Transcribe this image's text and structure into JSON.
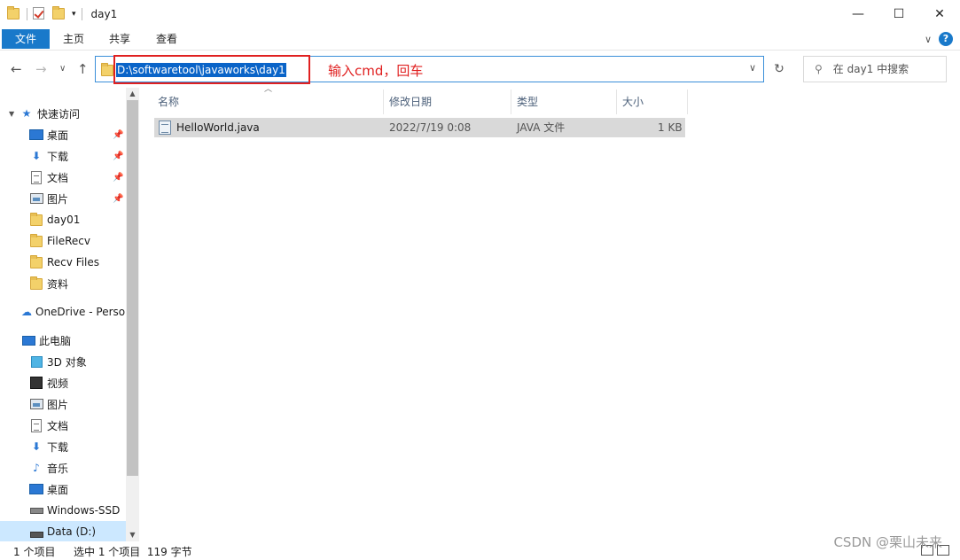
{
  "window": {
    "title": "day1",
    "minimize_glyph": "—",
    "maximize_glyph": "☐",
    "close_glyph": "✕"
  },
  "ribbon": {
    "tabs": [
      "文件",
      "主页",
      "共享",
      "查看"
    ],
    "collapse_glyph": "∨",
    "help_glyph": "?"
  },
  "navbar": {
    "back_glyph": "←",
    "forward_glyph": "→",
    "recent_glyph": "∨",
    "up_glyph": "↑",
    "address": "D:\\softwaretool\\javaworks\\day1",
    "dropdown_glyph": "∨",
    "refresh_glyph": "↻",
    "search_placeholder": "在 day1 中搜索",
    "search_glyph": "⚲"
  },
  "annotation": {
    "text": "输入cmd，回车",
    "color": "#e02020"
  },
  "sidebar": {
    "quick_access": "快速访问",
    "quick_items": [
      {
        "label": "桌面",
        "pinned": true
      },
      {
        "label": "下载",
        "pinned": true
      },
      {
        "label": "文档",
        "pinned": true
      },
      {
        "label": "图片",
        "pinned": true
      },
      {
        "label": "day01",
        "pinned": false
      },
      {
        "label": "FileRecv",
        "pinned": false
      },
      {
        "label": "Recv Files",
        "pinned": false
      },
      {
        "label": "资料",
        "pinned": false
      }
    ],
    "onedrive": "OneDrive - Personal",
    "this_pc": "此电脑",
    "pc_items": [
      "3D 对象",
      "视频",
      "图片",
      "文档",
      "下载",
      "音乐",
      "桌面",
      "Windows-SSD",
      "Data (D:)"
    ],
    "pin_glyph": "📌",
    "scroll_up": "▲",
    "scroll_down": "▼"
  },
  "columns": {
    "name": "名称",
    "date": "修改日期",
    "type": "类型",
    "size": "大小"
  },
  "files": [
    {
      "name": "HelloWorld.java",
      "date": "2022/7/19 0:08",
      "type": "JAVA 文件",
      "size": "1 KB"
    }
  ],
  "status": {
    "count": "1 个项目",
    "selected": "选中 1 个项目  119 字节"
  },
  "watermark": "CSDN @栗山未来",
  "colors": {
    "accent": "#1979ca",
    "selection": "#0a64c8",
    "row_selected": "#d9d9d9"
  }
}
